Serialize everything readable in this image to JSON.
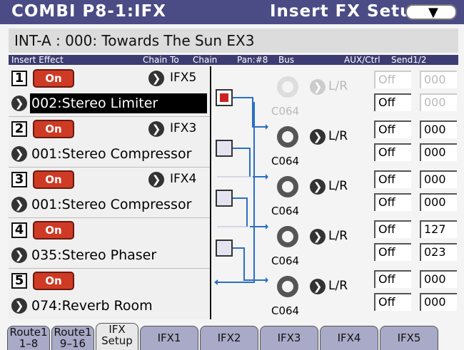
{
  "title": {
    "left": "COMBI  P8-1:IFX",
    "right": "Insert FX Setup",
    "menu_icon": "chevron-down"
  },
  "program": {
    "label": "INT-A   : 000: Towards The Sun      EX3"
  },
  "columns": [
    "Insert Effect",
    "Chain To",
    "Chain",
    "Pan:#8",
    "Bus",
    "AUX/Ctrl",
    "Send1/2"
  ],
  "slots": [
    {
      "num": "1",
      "on": "On",
      "chain_to": "IFX5",
      "effect": "002:Stereo Limiter",
      "chain_checked": true,
      "pan": "C064",
      "bus": "L/R",
      "ctrl_send1": "Off",
      "ctrl_send2": "Off",
      "send1": "000",
      "send2": "000",
      "dim": true
    },
    {
      "num": "2",
      "on": "On",
      "chain_to": "IFX3",
      "effect": "001:Stereo Compressor",
      "chain_checked": false,
      "pan": "C064",
      "bus": "L/R",
      "ctrl_send1": "Off",
      "ctrl_send2": "Off",
      "send1": "000",
      "send2": "000",
      "dim": false
    },
    {
      "num": "3",
      "on": "On",
      "chain_to": "IFX4",
      "effect": "001:Stereo Compressor",
      "chain_checked": false,
      "pan": "C064",
      "bus": "L/R",
      "ctrl_send1": "Off",
      "ctrl_send2": "Off",
      "send1": "000",
      "send2": "000",
      "dim": false
    },
    {
      "num": "4",
      "on": "On",
      "chain_to": "",
      "effect": "035:Stereo Phaser",
      "chain_checked": false,
      "pan": "C064",
      "bus": "L/R",
      "ctrl_send1": "Off",
      "ctrl_send2": "Off",
      "send1": "127",
      "send2": "023",
      "dim": false
    },
    {
      "num": "5",
      "on": "On",
      "chain_to": "",
      "effect": "074:Reverb Room",
      "chain_checked": null,
      "pan": "C064",
      "bus": "L/R",
      "ctrl_send1": "Off",
      "ctrl_send2": "Off",
      "send1": "000",
      "send2": "000",
      "dim": false
    }
  ],
  "tabs": [
    {
      "line1": "Route1",
      "line2": "1–8"
    },
    {
      "line1": "Route1",
      "line2": "9–16"
    },
    {
      "line1": "IFX",
      "line2": "Setup"
    },
    {
      "line1": "IFX1",
      "line2": ""
    },
    {
      "line1": "IFX2",
      "line2": ""
    },
    {
      "line1": "IFX3",
      "line2": ""
    },
    {
      "line1": "IFX4",
      "line2": ""
    },
    {
      "line1": "IFX5",
      "line2": ""
    }
  ],
  "colors": {
    "title_bg": "#4b4b85",
    "on_button": "#cf3a24",
    "chain_line": "#2a6fc4",
    "tab_bg": "#a9a9c8"
  }
}
